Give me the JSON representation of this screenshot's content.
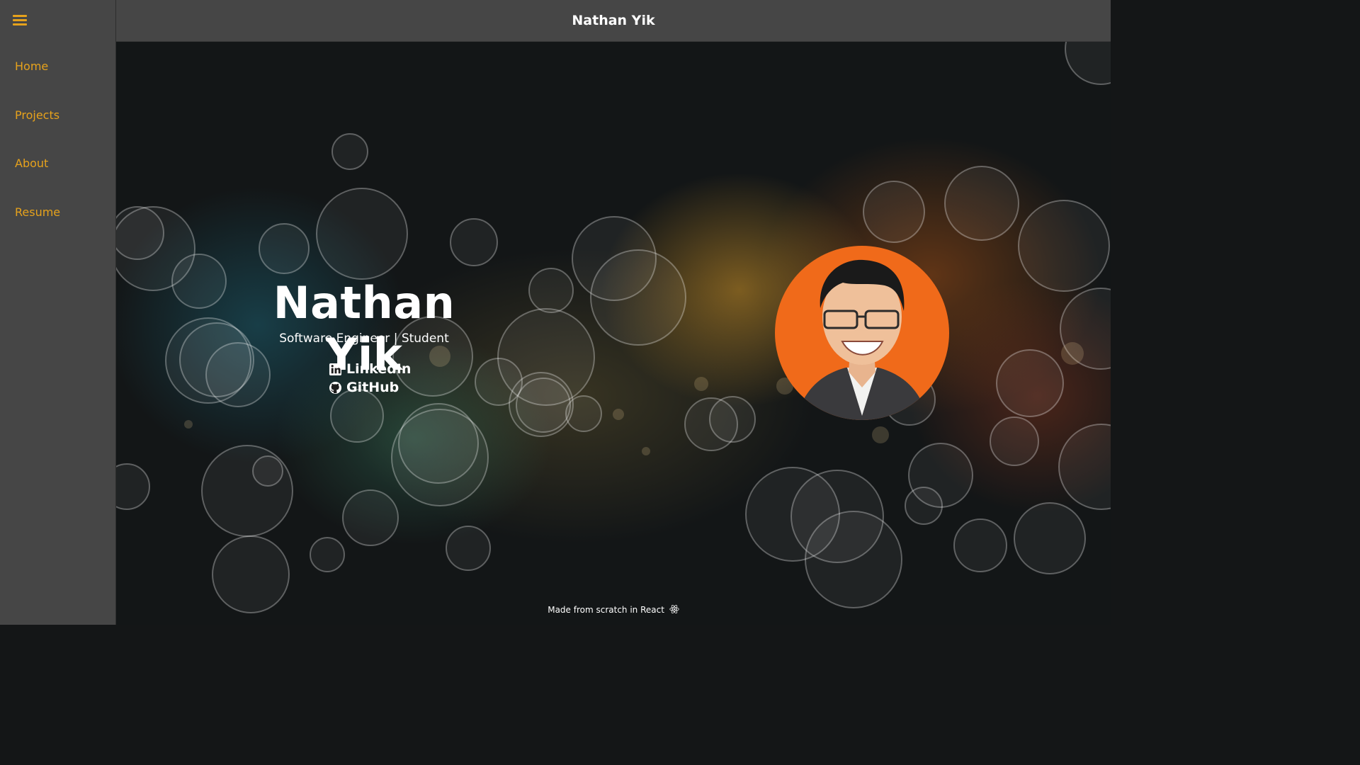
{
  "sidebar": {
    "menu_icon": "hamburger-menu-icon",
    "items": [
      {
        "label": "Home"
      },
      {
        "label": "Projects"
      },
      {
        "label": "About"
      },
      {
        "label": "Resume"
      }
    ]
  },
  "header": {
    "title": "Nathan Yik"
  },
  "hero": {
    "name": "Nathan Yik",
    "subtitle": "Software Engineer | Student",
    "links": [
      {
        "label": "LinkedIn",
        "icon": "linkedin-icon"
      },
      {
        "label": "GitHub",
        "icon": "github-icon"
      }
    ],
    "photo": "profile-photo"
  },
  "footer": {
    "text": "Made from scratch in React",
    "icon": "react-icon"
  },
  "colors": {
    "accent": "#e6a21c",
    "bar": "#464646",
    "avatar_bg": "#f06a1a",
    "text": "#ffffff"
  }
}
